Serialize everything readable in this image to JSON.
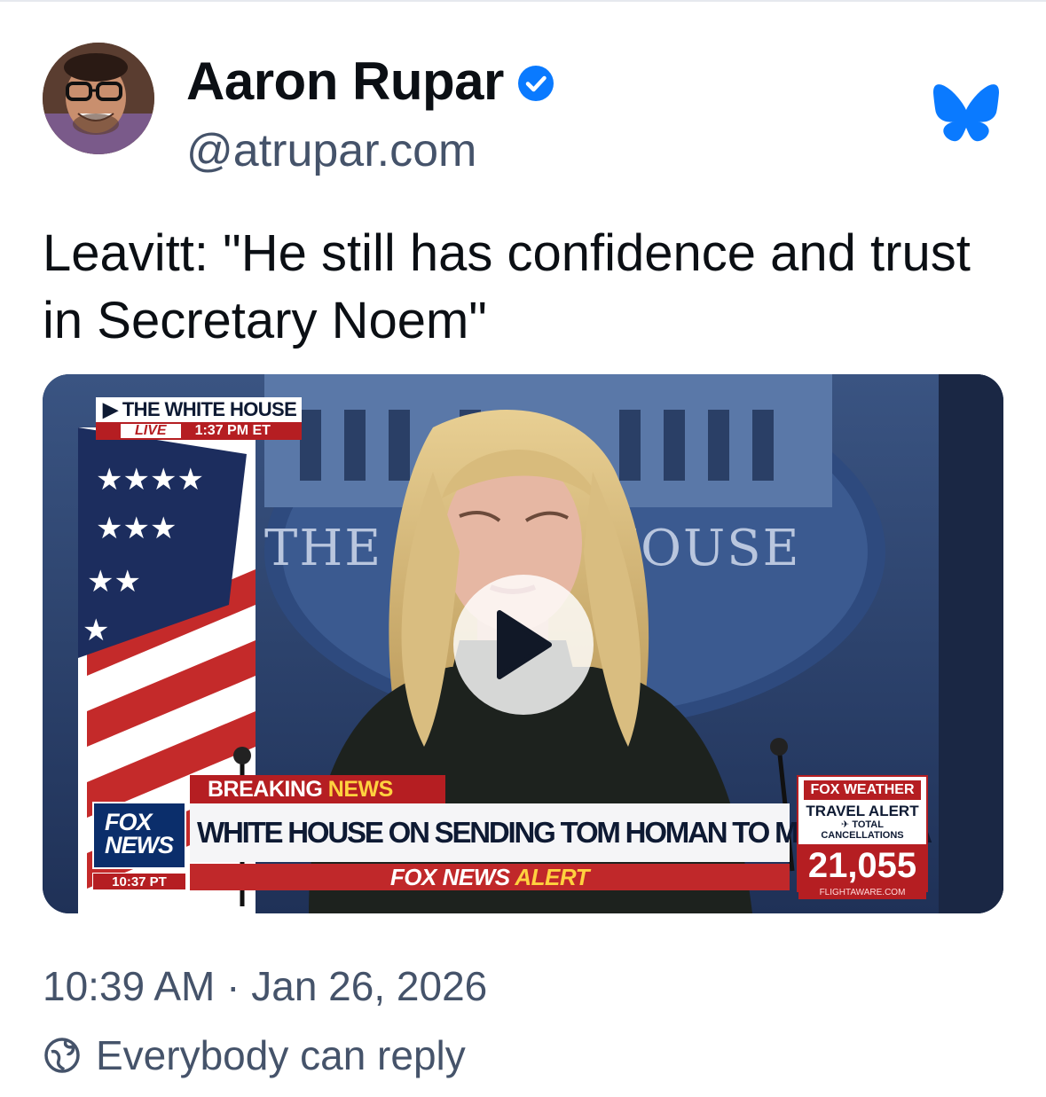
{
  "author": {
    "display_name": "Aaron Rupar",
    "handle": "@atrupar.com",
    "verified": true
  },
  "post": {
    "text": "Leavitt: \"He still has confidence and trust in Secretary Noem\""
  },
  "video": {
    "overlay": {
      "location": "THE WHITE HOUSE",
      "live_label": "LIVE",
      "live_time": "1:37 PM ET",
      "backdrop_text": "THE W          IOUSE",
      "network": "FOX NEWS",
      "network_time": "10:37 PT",
      "breaking_prefix": "BREAKING",
      "breaking_suffix": "NEWS",
      "headline": "WHITE HOUSE ON SENDING TOM HOMAN TO MINNESOTA",
      "alert_prefix": "FOX NEWS",
      "alert_suffix": "ALERT",
      "weather_brand": "FOX WEATHER",
      "weather_title": "TRAVEL ALERT",
      "weather_subtitle": "TOTAL CANCELLATIONS",
      "weather_count": "21,055",
      "weather_source": "FLIGHTAWARE.COM"
    }
  },
  "footer": {
    "timestamp": "10:39 AM · Jan 26, 2026",
    "reply_setting": "Everybody can reply"
  },
  "icons": {
    "verified": "verified-badge-icon",
    "bluesky": "bluesky-butterfly-icon",
    "play": "play-icon",
    "reply": "reply-permission-icon"
  },
  "colors": {
    "accent": "#0a7aff",
    "secondary_text": "#45536a",
    "fox_red": "#b51e22",
    "fox_blue": "#0b2e6b"
  }
}
